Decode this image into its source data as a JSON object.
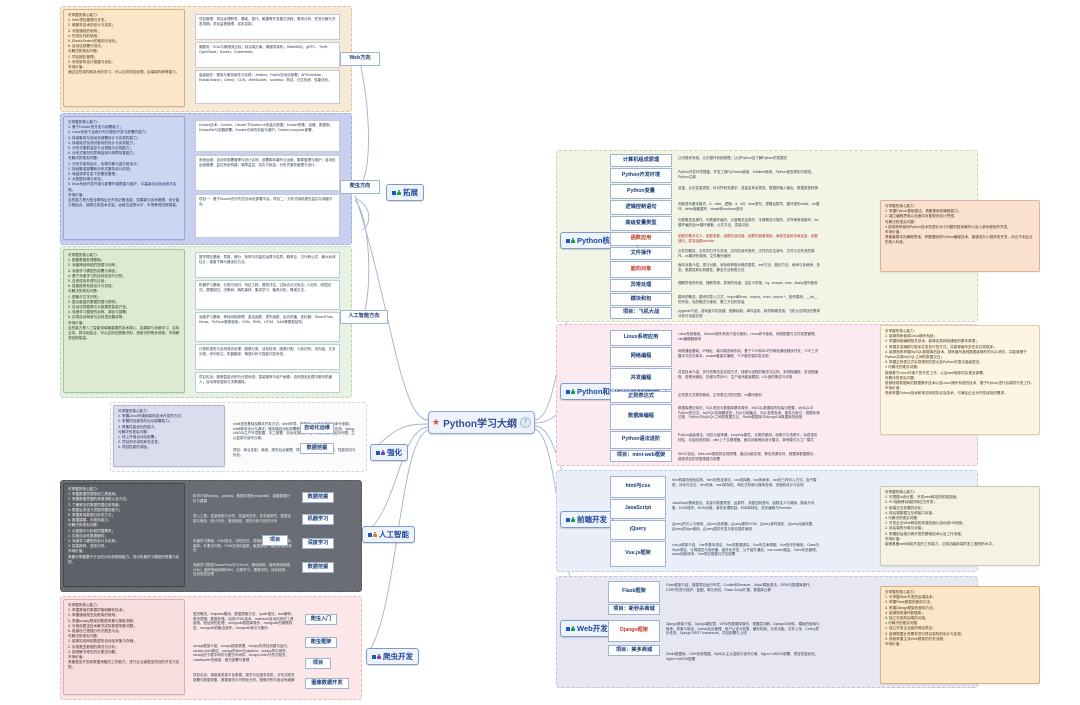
{
  "central": {
    "label": "Python学习大纲",
    "badge": "7",
    "star": "★"
  },
  "branches": {
    "expand": {
      "label": "拓展",
      "marks": "□♦"
    },
    "core": {
      "label": "Python核心编程",
      "marks": "□♦"
    },
    "advanced": {
      "label": "Python和Linux高级编程",
      "marks": "□♦"
    },
    "frontend": {
      "label": "前端开发",
      "marks": "□♦"
    },
    "web": {
      "label": "Web开发",
      "marks": "□♦"
    },
    "reinforce": {
      "label": "强化",
      "marks": "□♦"
    },
    "ai": {
      "label": "人工智能",
      "marks": "□♦"
    },
    "spider": {
      "label": "爬虫开发",
      "marks": "□♦"
    }
  },
  "directions": {
    "web": "Web方向",
    "spider": "爬虫方向",
    "ai": "人工智能方向",
    "opt": "自动化运维",
    "data": "数据挖掘",
    "entry": "爬虫入门",
    "framework": "爬虫框架",
    "project": "项目",
    "image": "图像数据开发",
    "ml": "机器学习",
    "dl": "深度学习",
    "datamine1": "数据挖掘",
    "datamine2": "数据挖掘",
    "datamine3": "数据挖掘"
  },
  "expand_section": {
    "card1": {
      "lines": [
        "可掌握的核心能力：",
        "1. Web项目管理与开发；",
        "2. 微服务技术的设计与实现；",
        "3. 消息通信的使用；",
        "4. 任务队列的使用；",
        "5. ElasticSearch的使用与优化；",
        "6. 自动化部署与测试。",
        "可解决的现实问题：",
        "1. 项目团队管理；",
        "2. 系统架构设计搭建与优化。",
        "市场价值：",
        "通过这些架构和技术的学习，可以达到项目经理、后端架构师等能力。"
      ]
    },
    "sub1": {
      "label": "",
      "detail": "项目管理：项目经理职责、基础、迭代、敏捷等开发模式流程；需求分析、任务分解与开发排期；项目监督管理、成本控制。",
      "detail2": "微服务：SOA与微服务比较；前后端分离；微服务架构；RabbitMQ、gRPC、Thrift、OpenStack；Docker、Kubernetes。",
      "detail3": "高级组件：框架与服务组件与实践：Jenkins、Fabric自动化部署；APScheduler、ElasticSearch；Celery；CDN；WebSocket、socketio；测试、日志系统、性能优化。"
    },
    "card2": {
      "lines": [
        "可掌握的核心能力：",
        "1. 基于Docker的开发与部署能力；",
        "2. Linux系统下运维分布式程序开发与部署的能力；",
        "3. 持续集成与自动化部署设计与实现的能力；",
        "4. 持续测试及测试驱动的设计与实现能力；",
        "5. 分布式集群监控平台搭建与实现能力；",
        "6. 分布式服务的异常检测与故障恢复能力。",
        "可解决的现实问题：",
        "1. 分布式架构设计，负载均衡与高可用设计；",
        "2. 持续集成部署和分布式服务设计实现；",
        "3. 海量请求并发下的服务管理；",
        "4. 大数据存储与优化；",
        "5. linux系统开发环境与部署环境搭建与维护，中高级自动化运维与实现。",
        "市场价值：",
        "这些能力是大型互联网企业开发必备技能，如果能与技术管理、设计能力相结合，能够达到技术总监、运维总监等水平，市场薪资回报极高。"
      ]
    },
    "sub2": {
      "detail": "Docker技术：Centos、Ubuntu下Docker-ce安装与配置；Docker镜像、容器、数据卷；Dockerfile与容器部署；Docker仓库的安装与维护；Docker-compose部署。"
    },
    "sub3": {
      "detail": "系统运维：自动化部署管理与设计实现；部署脚本编写与运维；集群管理与维护；自动化运维管理；监控系统构建；故障监控、容灾与恢复；分布式服务管理与设计。"
    },
    "sub4": {
      "detail": "项目一：基于Docker的分布式自动化部署平台。项目二：分布式网络爬虫监控与调度平台。"
    },
    "card3": {
      "lines": [
        "可掌握的核心能力：",
        "1. 图像数据处理基础；",
        "2. 深度神经网络的搭建与训练；",
        "3. 深度学习模型的部署与调优；",
        "4. 基于深度学习的目标检测与识别；",
        "5. 自然语言处理与应用；",
        "6. 智能推荐系统设计与实现。",
        "可解决的现实问题：",
        "1. 图像与文字识别；",
        "2. 复杂度高的数据挖掘与预测；",
        "3. 自动化的图像与大数据类智能产品；",
        "4. 深度学习模型的训练、调优与部署；",
        "5. 实现自动驾驶与自然语言翻译等。",
        "市场价值：",
        "这些能力是人工智能领域最重要的技术核心，如果能与深度学习、实际业务、算法相结合，可以应用在图像识别、语音识别等多领域，市场薪资回报极高。"
      ]
    },
    "sub5": {
      "detail": "数学理论基础：导数、微分、矩阵与向量的运算与性质；概率论、贝叶斯公式、最大似然估计；梯度下降与最优化方法。"
    },
    "sub6": {
      "detail": "机器学习基础：分类与回归、特征工程、模型评估、过拟合与欠拟合；K近邻、线性回归、逻辑回归、决策树、随机森林、集成学习、聚类分析、降维方法。"
    },
    "sub7": {
      "detail": "深度学习基础：神经网络原理、激活函数、损失函数、反向传播、优化器；TensorFlow、Keras、PyTorch框架使用；CNN、RNN、LSTM、GAN等模型结构。"
    },
    "sub8": {
      "detail": "计算机视觉与自然语言处理：图像分类、目标检测、图像分割、人脸识别；词向量、文本分类、序列标注、机器翻译、情感分析与智能问答系统。"
    },
    "sub9": {
      "detail": "项目实战：图像智能识别与分类系统；智能推荐与用户画像；自然语言处理与聊天机器人；自动驾驶感知与决策模拟。"
    }
  },
  "reinforce_section": {
    "card": {
      "lines": [
        "可掌握的核心能力：",
        "1. 掌握Linux环境和架构技术开发的方式；",
        "2. 掌握项目服务的自动部署能力；",
        "3. 具备性能优化的能力。",
        "可解决的现实问题：",
        "1. 线上环境自动化部署；",
        "2. 项目的可用性和安全性；",
        "3. 项目性能的调优。"
      ]
    },
    "detail": "shell语言基础及脚本开发方式；shell环境、变量式、命令行执行与命令参数；shell脚本设计与调试；服务器自动化部署脚本的编写；性能优化与压测；djang-uWSGI生产环境配置、手工部署、自动化部署；Nginx负载均衡与反向代理；主从复制与读写分离。",
    "detail2": "项目：商业定制、商城、爬虫后台管理、项目部署上线与运维管理、性能测试与优化。"
  },
  "core_section": {
    "sub": [
      {
        "label": "计算机组成原理",
        "detail": "认识操作系统，认识操作系统原理，认识Python及了解Python的发展史"
      },
      {
        "label": "Python开发环境",
        "detail": "Python开发环境搭建、开发工具PyCharm使用、Sublime使用、Python语言规则与规范、Python注释"
      },
      {
        "label": "Python变量",
        "detail": "变量、认识变量类型、标识符和关键字、变量名命名规范、数据的输入输出、数据类型转换"
      },
      {
        "label": "逻辑控制语句",
        "detail": "判断语句基本格式、if、else、逻辑、if、elif、else语句、逻辑运算符、循环语句while、for循环、while嵌套循环、break和continue语句"
      },
      {
        "label": "高级变量类型",
        "detail": "列表概念及操作、列表循环遍历、元组概念及操作、字典概念与操作、字符串常用操作、for循环遍历及for循环嵌套、公共方法、变量引用"
      },
      {
        "label": "函数应用",
        "detail": "函数的基本定义、函数参数、函数的返回值、函数的嵌套调用、局部变量和全局变量、函数递归、匿名函数lambda"
      },
      {
        "label": "文件操作",
        "detail": "文件的概念、文件的打开与关闭、文件的读写操作、文件的定位读写、文件与文件夹的操作、os模块的使用、文件备份案例"
      },
      {
        "label": "面向对象",
        "detail": "面向对象介绍、类与对象、添加和获取对象的属性、self方法、魔法方法、继承与多继承、多态、类属性和实例属性、静态方法和类方法"
      },
      {
        "label": "异常处理",
        "detail": "理解异常的作用、捕获异常、异常的传递、自定义异常、try...except...else...finally语句使用"
      },
      {
        "label": "模块和包",
        "detail": "模块的概念、模块的导入方式、import和from...import、from...import *、制作模块、__all__的作用、包的概念与使用、第三方包的安装"
      },
      {
        "label": "项目：飞机大战",
        "detail": "pygame介绍、游戏窗口的创建、图像绘制、事件监听、精灵和精灵组、飞机大战项目的需求分析与功能实现"
      }
    ],
    "card": {
      "lines": [
        "可掌握的核心能力：",
        "1. 掌握Python基础语法，具备基础的编程能力；",
        "2. 建立编程思维以及面向对象程序设计思想。",
        "可解决的现实问题：",
        "能够熟练使用Python技术完成针对小问题的程序编写以及小游戏程序的开发。",
        "市场价值：",
        "具备最基本的编程思维，掌握基础的Python编程技术，能够成为小程序的开发，尚达不到企业的用人标准。"
      ]
    }
  },
  "advanced_section": {
    "sub": [
      {
        "label": "Linux系统应用",
        "detail": "Linux系统使用、Ubuntu操作系统介绍与使用、Linux命令使用、网络配置与文件权限管理、vim编辑器使用"
      },
      {
        "label": "网络编程",
        "detail": "网络通信基础、IP地址、端口概念和作用、基于TCP和UDP的网络通信程序开发、TCP三次握手与四次挥手、socket套接字编程、TCP服务端并发实现"
      },
      {
        "label": "并发编程",
        "detail": "并发技术介绍、多任务概念及实现方式、线程与进程的概念与区别、多线程编程、多进程编程、进程间通信、协程与异步IO、生产者消费者模型、GIL锁的概念与作用"
      },
      {
        "label": "正则表达式",
        "detail": "正则表达式规则使用、正则表达式的匹配、re模块使用"
      },
      {
        "label": "数据库编程",
        "detail": "数据库理论知识、SQL语言与数据库基本操作、MySQL数据库的安装与配置、MySQL中Python的交互、MySQL的增删改查、SQL分组聚合、SQL多表查询、事务与索引、视图存储过程、Python与MySQL之间的数据交互、Redis数据库与MongoDB数据库的使用"
      },
      {
        "label": "Python语法进阶",
        "detail": "Python高级语法、闭包与装饰器、property属性、元类的使用、深拷贝与浅拷贝、动态语言特性、垃圾回收机制、with上下文管理器、面向对象程序设计模式、单例模式与工厂模式"
      },
      {
        "label": "项目：mini-web框架",
        "detail": "WSGI协议、Mini-web框架的实现原理、路由功能实现、静态资源访问、数据库数据展示、框架项目的完整搭建与部署"
      }
    ],
    "card": {
      "lines": [
        "可掌握的核心能力：",
        "1. 能够熟练使用Linux操作系统；",
        "2. 掌握网络编程相关技术，能够实现网络通信的基本原理；",
        "3. 掌握并发编程与程序并发执行的方式，并能够编写多任务并发程序；",
        "4. 能够熟练掌握MySQL数据库的技术，熟练编写各种数据库操作的SQL语句，并能够基于Python实现MySQL之间的数据交互；",
        "5. 掌握正则表达式实现规则匹配以及Python的语法高级语法。",
        "可解决的现实问题：",
        "能够基于Linux环境下的开发工作，以及web程序的实现及部署。",
        "可解决的现实问题：",
        "能够使用数据库的数据操作技术以及Linux操作系统的技术，基于Python进行后端的开发工作。",
        "市场价值：",
        "熟练掌握Python技术和常见网络协议及技术，可满足企业对开发经验的需求。"
      ]
    }
  },
  "frontend_section": {
    "sub": [
      {
        "label": "html与css",
        "detail": "html构建页面及结构、html标签及用法、css选择器、css的继承、css的三种引入方式、盒子模型、浮动与定位、flex布局、css3新特性、响应式布局与媒体查询、页面的设计与实现"
      },
      {
        "label": "JavaScript",
        "detail": "JavaScript基础语法、变量与数据类型、运算符、流程控制语句、函数定义与调用、数组与对象、DOM操作、BOM对象、事件处理机制、ES6新特性、异步编程与Promise"
      },
      {
        "label": "jQuery",
        "detail": "jQuery的引入与使用、jQuery选择器、jQuery操作DOM、jQuery事件绑定、jQuery动画效果、jQuery的Ajax使用、jQuery插件开发与常见插件使用"
      },
      {
        "label": "Vue.js框架",
        "detail": "vue.js框架介绍、Vue的基本语法、Vue的数据绑定、Vue的生命周期、Vue指令的使用、Class与Style绑定、计算属性与侦听器、组件化开发、父子组件通信、vue-router路由、Vuex状态管理、axios网络请求、Vue项目搭建与打包部署"
      }
    ],
    "card": {
      "lines": [
        "可掌握的核心能力：",
        "1. 可根据ui设计图，开发web网站的前端页面；",
        "2. PC端和移动端的响应式开发；",
        "3. 前端交互效果的优化；",
        "4. 前后端数据交互和接口对接。",
        "可解决的现实问题：",
        "1. 开发企业Web网站的前端页面以及动态H5页面；",
        "2. 前后端的分离与对接；",
        "3. 掌握前后端分离开发的基础技术以及工作流程。",
        "市场价值：",
        "能够具备web网站开发的工作能力，达到初级前端开发工程师的水平。"
      ]
    }
  },
  "web_section": {
    "sub": [
      {
        "label": "Flask框架",
        "detail": "Flask框架介绍、搭建项目运行环境、Cookie和Session、Jinja2模板语法、ORM与数据库操作、CSRF防范与保护、蓝图、单元测试、Flask-Script扩展、数据库迁移",
        "proj": "项目：新秒杀商城"
      },
      {
        "label": "Django框架",
        "detail": "Django框架介绍、Django模型层、ORM的数据库操作、视图层详解、Django中间件、模板的使用与继承、表单与验证、Admin后台管理、用户认证与权限、缓存机制、分页功能、文件上传、Celery异步任务、Django REST framework、项目部署与上线",
        "proj": "项目：美多商城"
      },
      {
        "label": "",
        "detail": "Redis数据库、CMS系统搭建、MySQL主从复制与读写分离、Nginx+uWSGI部署、项目性能优化、Nginx+uWSGI配置"
      }
    ],
    "card": {
      "lines": [
        "可掌握的核心能力：",
        "1. 可掌握Web开发的后端技术；",
        "2. 掌握Flask框架的使用方法；",
        "3. 掌握Django框架的使用方法；",
        "4. 能够熟练操作数据库；",
        "5. 独立完成前后端的对接。",
        "可解决的现实问题：",
        "1. 独立开发企业级的网站项目；",
        "2. 能够根据业务需求进行项目架构的设计与实现；",
        "3. 熟练掌握主流Web框架的开发流程。",
        "市场价值：",
        "能够胜任web全栈工程师，可达到中级开发工程师的能力与薪资水平。"
      ]
    }
  },
  "ai_section": {
    "card": {
      "lines": [
        "可掌握的核心能力：",
        "1. 掌握数据挖掘常用工具使用；",
        "2. 掌握数据挖掘的常规流程以及方法；",
        "3. 了解常见的数据挖掘应用场景；",
        "4. 根据业务定义挖掘问题的能力；",
        "5. 掌握常用数据分析的方法；",
        "6. 数据建模、可视化能力。",
        "可解决的现实问题：",
        "1. 从数据中分析和挖掘需求；",
        "2. 实现自动化数据解析；",
        "3. 深度学习模型的设计与实现；",
        "4. 智能推荐、语言识别。",
        "市场价值：",
        "具备可掌握基于行业的分析和预测能力，进行机器学习模型的搭建与实现。"
      ]
    },
    "detail1": "科学计算Numpy、pandas、数据可视化matplotlib、金融数据分析与建模",
    "detail2": "导入工具、变量使用与分布、变量间关系、多变量研究、图表绘制与美化、统计分析、假设检验、相关分析与回归分析",
    "detail3": "机器学习基础：KNN算法、线性回归、逻辑回归、决策树、随机森林、朴素贝叶斯、SVM支持向量机、聚类算法、模型评估与调优",
    "detail4": "深度学习框架TensorFlow与PyTorch、神经网络、卷积神经网络CNN、循环神经网络RNN、迁移学习、图像识别、目标检测、自然语言处理"
  },
  "spider_section": {
    "card": {
      "lines": [
        "可掌握的核心能力：",
        "1. 掌握常用的数据抓取和解析技术；",
        "2. 掌握通用爬虫及框架的使用；",
        "3. 掌握scrapy框架的数据采集与爬取流程；",
        "4. 可使用爬虫技术解决实际数据采集问题；",
        "5. 能够自己搭建分布式爬虫平台。",
        "可解决的现实问题：",
        "1. 能够实现网络数据的自动化采集与存储；",
        "2. 实现爬虫数据的清洗与分析；",
        "3. 能够解决常见的反爬虫问题。",
        "市场价值：",
        "具备爬虫开发和数据采集的工作能力，进行企业级爬虫项目的开发与实现。"
      ]
    },
    "detail1": "爬虫概念、requests模块、数据提取方法、xpath语法、lxml解析、爬虫逻辑、数据存储、动态HTML技术、selenium自动化测试工具使用、验证码的处理、mongodb数据库操作、mongodb的增删改查、mongodb的聚合操作、mongodb索引与备份",
    "detail2": "scrapy框架介绍、scrapy框架原理、scrapy的项目创建与运行、scrapy shell调试、scrapy的item与pipeline、scrapy的中间件、scrapy的下载中间件与爬虫中间件、scrapy-redis分布式爬虫、crawlspider的使用、爬虫部署与管理",
    "detail3": "项目实战：爬取某电商平台数据、爬虫与反爬虫攻防、分布式爬虫部署与数据采集、数据清洗与可视化分析、图像识别与验证码破解"
  }
}
